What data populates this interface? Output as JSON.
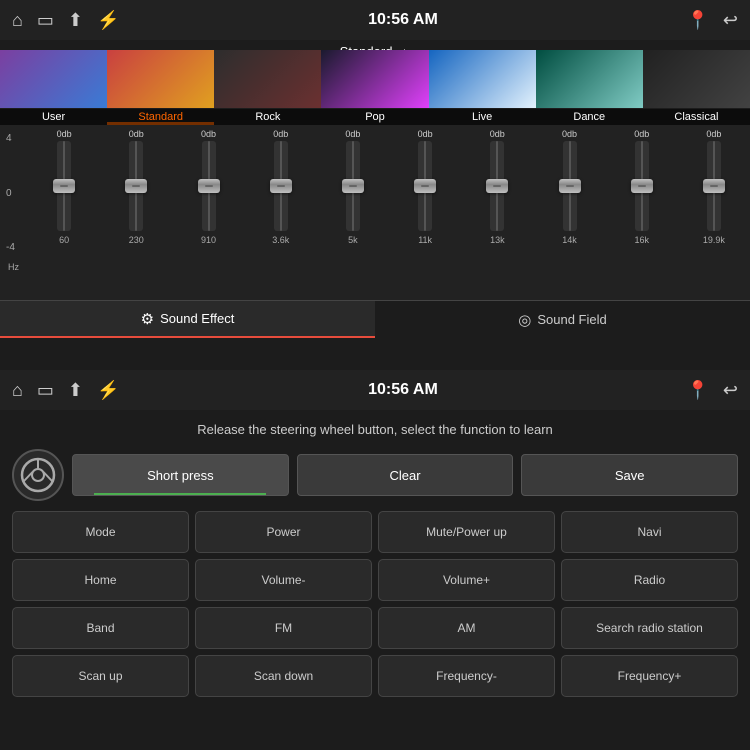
{
  "top": {
    "status": {
      "time": "10:56 AM"
    },
    "preset_label": "Standard",
    "presets": [
      {
        "id": "user",
        "name": "User",
        "class": "thumb-user",
        "active": false
      },
      {
        "id": "standard",
        "name": "Standard",
        "class": "thumb-std",
        "active": true
      },
      {
        "id": "rock",
        "name": "Rock",
        "class": "thumb-rock",
        "active": false
      },
      {
        "id": "pop",
        "name": "Pop",
        "class": "thumb-pop",
        "active": false
      },
      {
        "id": "live",
        "name": "Live",
        "class": "thumb-live",
        "active": false
      },
      {
        "id": "dance",
        "name": "Dance",
        "class": "thumb-dance",
        "active": false
      },
      {
        "id": "classical",
        "name": "Classical",
        "class": "thumb-classical",
        "active": false
      }
    ],
    "bands": [
      {
        "db": "0db",
        "freq": "60"
      },
      {
        "db": "0db",
        "freq": "230"
      },
      {
        "db": "0db",
        "freq": "910"
      },
      {
        "db": "0db",
        "freq": "3.6k"
      },
      {
        "db": "0db",
        "freq": "5k"
      },
      {
        "db": "0db",
        "freq": "11k"
      },
      {
        "db": "0db",
        "freq": "13k"
      },
      {
        "db": "0db",
        "freq": "14k"
      },
      {
        "db": "0db",
        "freq": "16k"
      },
      {
        "db": "0db",
        "freq": "19.9k"
      }
    ],
    "db_labels": [
      "4",
      "0",
      "-4"
    ],
    "hz_label": "Hz",
    "tabs": [
      {
        "label": "Sound Effect",
        "active": true
      },
      {
        "label": "Sound Field",
        "active": false
      }
    ]
  },
  "bottom": {
    "status": {
      "time": "10:56 AM"
    },
    "instruction": "Release the steering wheel button, select the function to learn",
    "controls": {
      "short_press": "Short press",
      "clear": "Clear",
      "save": "Save"
    },
    "functions": [
      "Mode",
      "Power",
      "Mute/Power up",
      "Navi",
      "Home",
      "Volume-",
      "Volume+",
      "Radio",
      "Band",
      "FM",
      "AM",
      "Search radio station",
      "Scan up",
      "Scan down",
      "Frequency-",
      "Frequency+"
    ]
  },
  "icons": {
    "home": "⌂",
    "window": "▭",
    "up_arrows": "⇑",
    "usb": "⚡",
    "location": "📍",
    "back": "↩",
    "eq_icon": "⊞",
    "sound_field_icon": "◎",
    "steering": "🎮"
  }
}
